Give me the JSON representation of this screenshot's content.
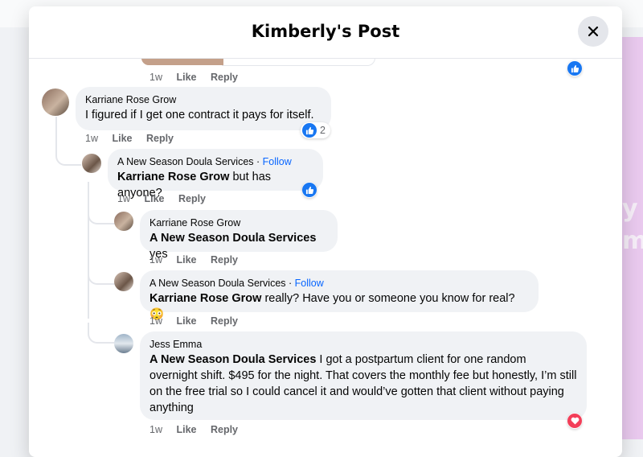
{
  "post": {
    "title": "Kimberly's Post"
  },
  "colors": {
    "accent": "#0866ff",
    "like_blue": "#1877f2",
    "love_red": "#f33e58"
  },
  "top_comment": {
    "time": "1w",
    "like": "Like",
    "reply": "Reply"
  },
  "comments": [
    {
      "author": "Karriane Rose Grow",
      "text": "I figured if I get one contract it pays for itself.",
      "time": "1w",
      "like": "Like",
      "reply": "Reply",
      "reaction_icon": "like-icon",
      "reaction_count": "2"
    },
    {
      "author": "A New Season Doula Services",
      "follow": "Follow",
      "mention": "Karriane Rose Grow",
      "text": " but has anyone?",
      "time": "1w",
      "like": "Like",
      "reply": "Reply",
      "reaction_icon": "like-icon"
    },
    {
      "author": "Karriane Rose Grow",
      "mention": "A New Season Doula Services",
      "text": " yes",
      "time": "1w",
      "like": "Like",
      "reply": "Reply"
    },
    {
      "author": "A New Season Doula Services",
      "follow": "Follow",
      "mention": "Karriane Rose Grow",
      "text": " really? Have you or someone you know for real? 😳",
      "time": "1w",
      "like": "Like",
      "reply": "Reply"
    },
    {
      "author": "Jess Emma",
      "mention": "A New Season Doula Services",
      "text": " I got a postpartum client for one random overnight shift. $495 for the night. That covers the monthly fee but honestly, I’m still on the free trial so I could cancel it and would’ve gotten that client without paying anything",
      "time": "1w",
      "like": "Like",
      "reply": "Reply",
      "reaction_icon": "love-icon"
    }
  ]
}
